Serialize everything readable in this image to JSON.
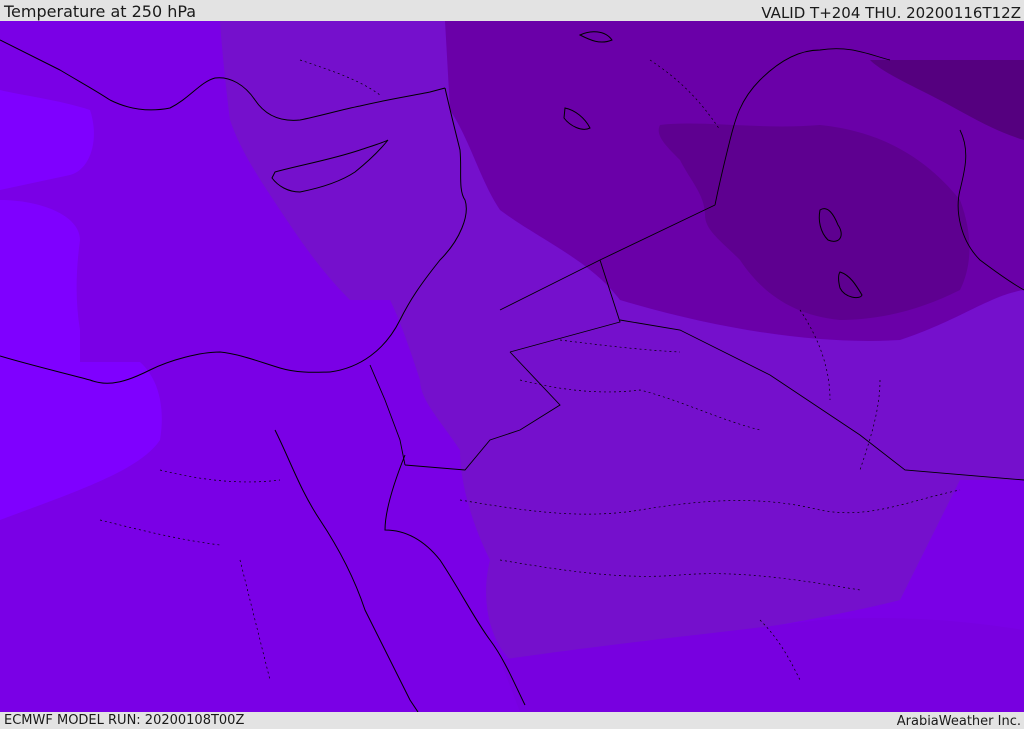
{
  "header": {
    "title": "Temperature at 250 hPa",
    "valid": "VALID T+204 THU. 20200116T12Z"
  },
  "footer": {
    "model_run": "ECMWF MODEL RUN: 20200108T00Z",
    "credit": "ArabiaWeather Inc."
  },
  "map": {
    "field": "temperature_250hPa",
    "color_bands": [
      "#7f00ff",
      "#7a00e6",
      "#7510cc",
      "#6a00a8",
      "#5e0090"
    ]
  }
}
